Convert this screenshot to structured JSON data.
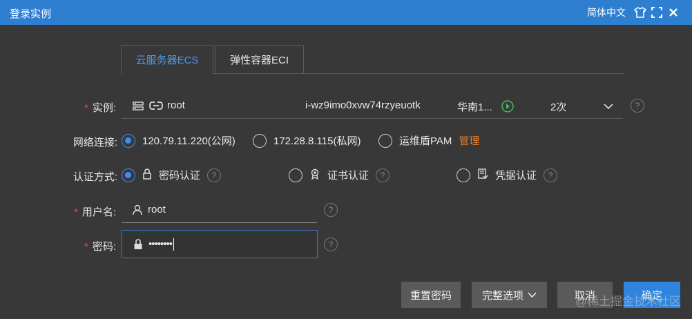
{
  "window": {
    "title": "登录实例",
    "language": "简体中文"
  },
  "tabs": [
    {
      "label": "云服务器ECS",
      "active": true
    },
    {
      "label": "弹性容器ECI",
      "active": false
    }
  ],
  "instance": {
    "label": "实例:",
    "user": "root",
    "id": "i-wz9imo0xvw74rzyeuotk",
    "region": "华南1...",
    "count": "2次"
  },
  "network": {
    "label": "网络连接:",
    "options": [
      {
        "label": "120.79.11.220(公网)",
        "selected": true
      },
      {
        "label": "172.28.8.115(私网)",
        "selected": false
      },
      {
        "label": "运维盾PAM",
        "selected": false
      }
    ],
    "manage_link": "管理"
  },
  "auth": {
    "label": "认证方式:",
    "options": [
      {
        "label": "密码认证",
        "icon": "lock-icon",
        "selected": true
      },
      {
        "label": "证书认证",
        "icon": "certificate-icon",
        "selected": false
      },
      {
        "label": "凭据认证",
        "icon": "credential-icon",
        "selected": false
      }
    ]
  },
  "username": {
    "label": "用户名:",
    "value": "root"
  },
  "password": {
    "label": "密码:",
    "value": "••••••••"
  },
  "buttons": {
    "reset": "重置密码",
    "full_options": "完整选项",
    "cancel": "取消",
    "confirm": "确定"
  },
  "watermark": "@稀土掘金技术社区",
  "colors": {
    "titlebar": "#2f7fd1",
    "accent": "#3b8ff0",
    "required": "#e04b4b",
    "manage_link": "#e07b2c",
    "background": "#383838"
  }
}
